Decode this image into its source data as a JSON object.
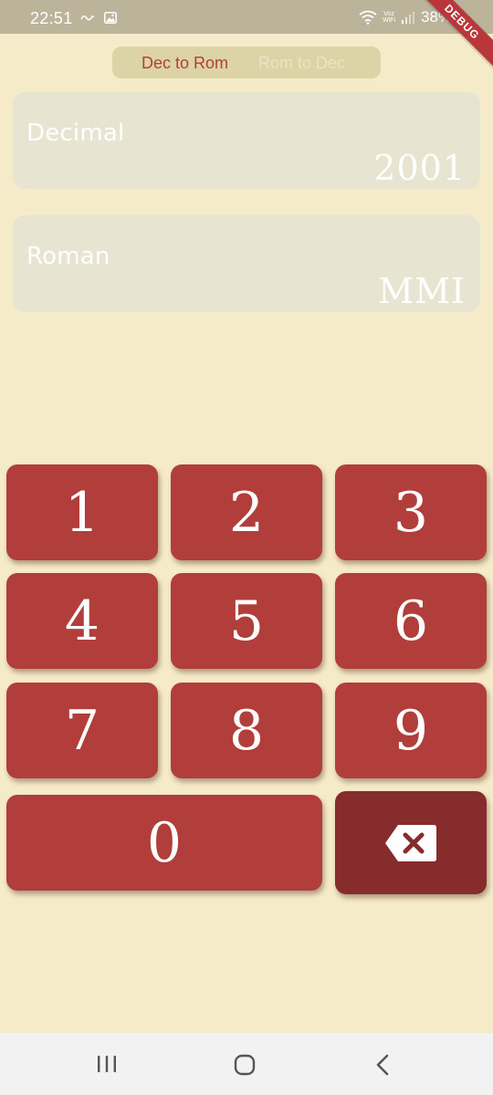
{
  "status": {
    "time": "22:51",
    "network_label_top": "Voz",
    "network_label_bottom": "WiFi",
    "battery": "38%",
    "debug_banner": "DEBUG"
  },
  "mode_toggle": {
    "dec_to_rom": "Dec to Rom",
    "rom_to_dec": "Rom to Dec"
  },
  "decimal_field": {
    "label": "Decimal",
    "value": "2001"
  },
  "roman_field": {
    "label": "Roman",
    "value": "MMI"
  },
  "keypad": {
    "k1": "1",
    "k2": "2",
    "k3": "3",
    "k4": "4",
    "k5": "5",
    "k6": "6",
    "k7": "7",
    "k8": "8",
    "k9": "9",
    "k0": "0"
  },
  "colors": {
    "background": "#f6ebc9",
    "key": "#b13e3b",
    "backspace_key": "#862c2d",
    "active_mode_text": "#b53d3c"
  },
  "icons": {
    "backspace": "backspace-icon",
    "recent_apps": "recent-apps-icon",
    "home": "home-icon",
    "back": "back-icon"
  }
}
